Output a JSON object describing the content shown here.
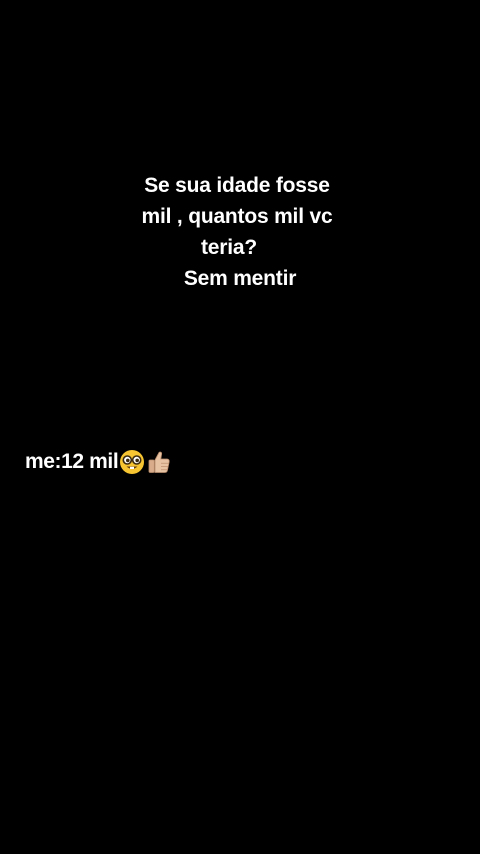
{
  "question": {
    "lines": [
      "Se sua idade fosse",
      "mil , quantos mil vc",
      "teria?",
      "Sem mentir"
    ]
  },
  "answer": {
    "text": "me:12 mil",
    "emojis": [
      "nerd-face-icon",
      "thumbs-up-icon"
    ]
  },
  "colors": {
    "background": "#000000",
    "text": "#ffffff",
    "emoji_face": "#f7c531",
    "emoji_skin": "#e7c3a4"
  }
}
